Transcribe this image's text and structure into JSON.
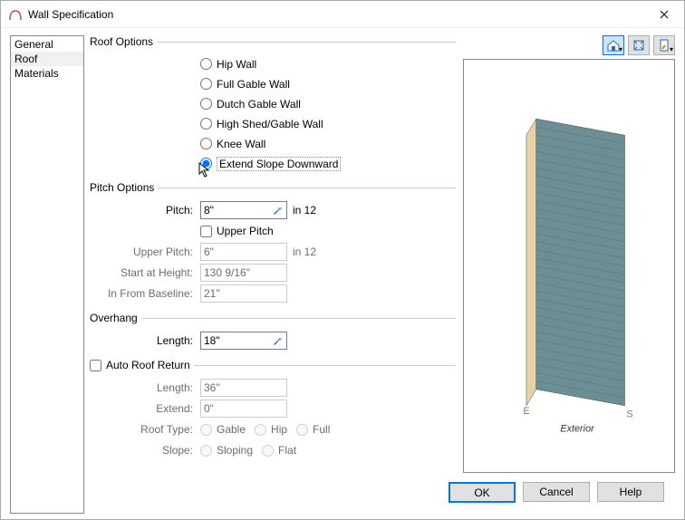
{
  "window": {
    "title": "Wall Specification"
  },
  "sidebar": {
    "items": [
      {
        "label": "General",
        "selected": false
      },
      {
        "label": "Roof",
        "selected": true
      },
      {
        "label": "Materials",
        "selected": false
      }
    ]
  },
  "roof_options": {
    "legend": "Roof Options",
    "choices": [
      {
        "label": "Hip Wall",
        "checked": false
      },
      {
        "label": "Full Gable Wall",
        "checked": false
      },
      {
        "label": "Dutch Gable Wall",
        "checked": false
      },
      {
        "label": "High Shed/Gable Wall",
        "checked": false
      },
      {
        "label": "Knee Wall",
        "checked": false
      },
      {
        "label": "Extend Slope Downward",
        "checked": true
      }
    ]
  },
  "pitch_options": {
    "legend": "Pitch Options",
    "pitch_label": "Pitch:",
    "pitch_value": "8\"",
    "pitch_suffix": "in 12",
    "upper_pitch_cb": "Upper Pitch",
    "upper_pitch_label": "Upper Pitch:",
    "upper_pitch_value": "6\"",
    "upper_pitch_suffix": "in 12",
    "start_height_label": "Start at Height:",
    "start_height_value": "130 9/16\"",
    "in_from_baseline_label": "In From Baseline:",
    "in_from_baseline_value": "21\""
  },
  "overhang": {
    "legend": "Overhang",
    "length_label": "Length:",
    "length_value": "18\""
  },
  "auto_roof_return": {
    "legend": "Auto Roof Return",
    "length_label": "Length:",
    "length_value": "36\"",
    "extend_label": "Extend:",
    "extend_value": "0\"",
    "roof_type_label": "Roof Type:",
    "roof_type_options": [
      {
        "label": "Gable"
      },
      {
        "label": "Hip"
      },
      {
        "label": "Full"
      }
    ],
    "slope_label": "Slope:",
    "slope_options": [
      {
        "label": "Sloping"
      },
      {
        "label": "Flat"
      }
    ]
  },
  "preview": {
    "toolbar_icons": [
      "house-icon",
      "expand-icon",
      "page-icon"
    ],
    "caption": "Exterior",
    "compass_e": "E",
    "compass_s": "S",
    "colors": {
      "siding": "#6c8f95",
      "trim": "#e5d2a8",
      "edge": "#3a3a3a"
    }
  },
  "buttons": {
    "ok": "OK",
    "cancel": "Cancel",
    "help": "Help"
  }
}
